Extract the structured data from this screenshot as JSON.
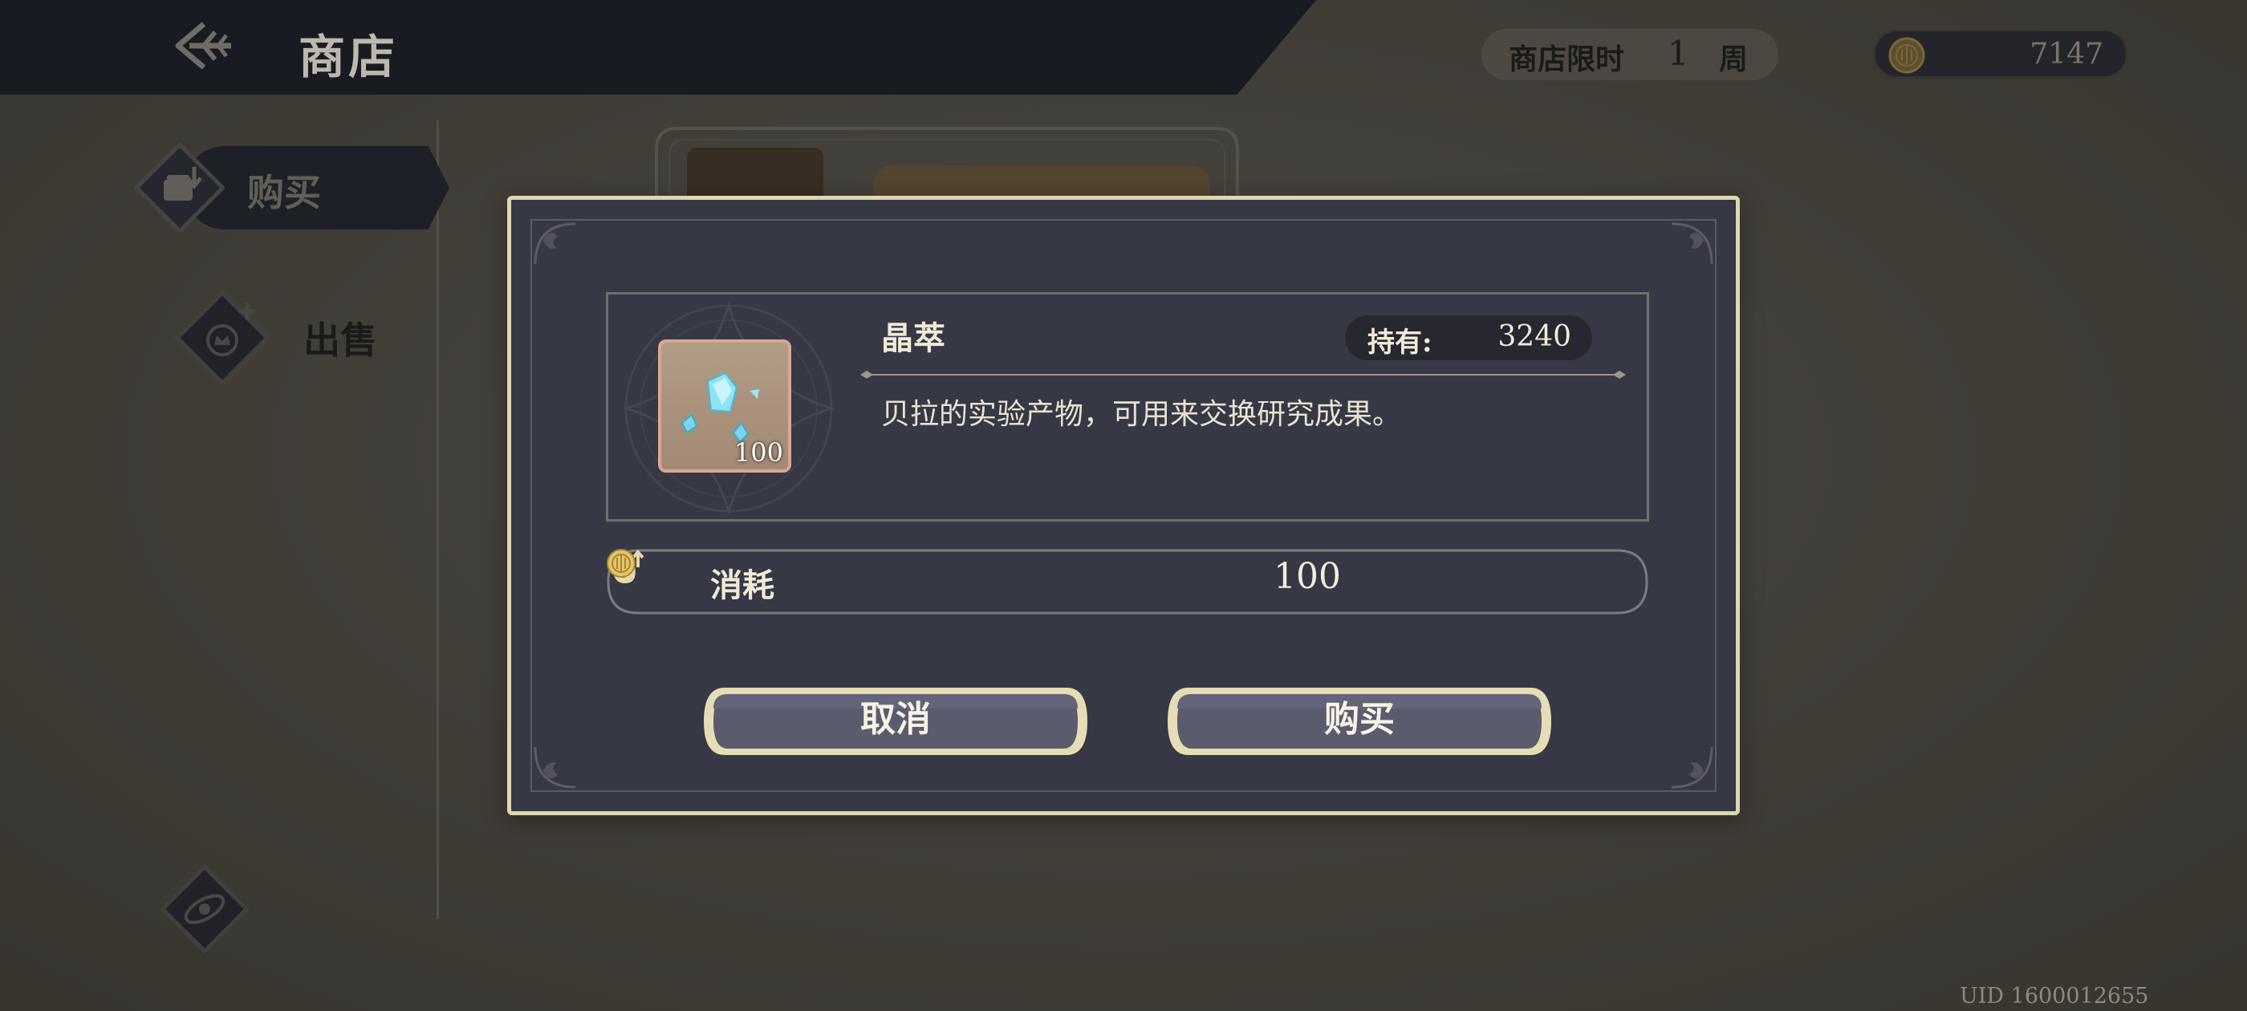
{
  "header": {
    "title": "商店",
    "limit_label": "商店限时",
    "limit_value": "1",
    "limit_unit": "周",
    "currency_amount": "7147"
  },
  "nav": {
    "buy_label": "购买",
    "sell_label": "出售"
  },
  "dialog": {
    "item_name": "晶萃",
    "item_icon_quantity": "100",
    "owned_label": "持有:",
    "owned_value": "3240",
    "description": "贝拉的实验产物，可用来交换研究成果。",
    "cost_label": "消耗",
    "cost_value": "100",
    "cancel_label": "取消",
    "confirm_label": "购买"
  },
  "footer": {
    "uid": "UID 1600012655"
  },
  "colors": {
    "modal_bg": "#363845",
    "gold_border": "#e0d6b0",
    "header_bg": "#1d1f28",
    "button_fill": "#5a5c6e"
  },
  "icons": [
    "back-arrow-icon",
    "gold-coin-icon",
    "buy-chest-icon",
    "sell-crown-icon",
    "orbit-icon",
    "crystal-item-icon",
    "money-bag-icon"
  ]
}
